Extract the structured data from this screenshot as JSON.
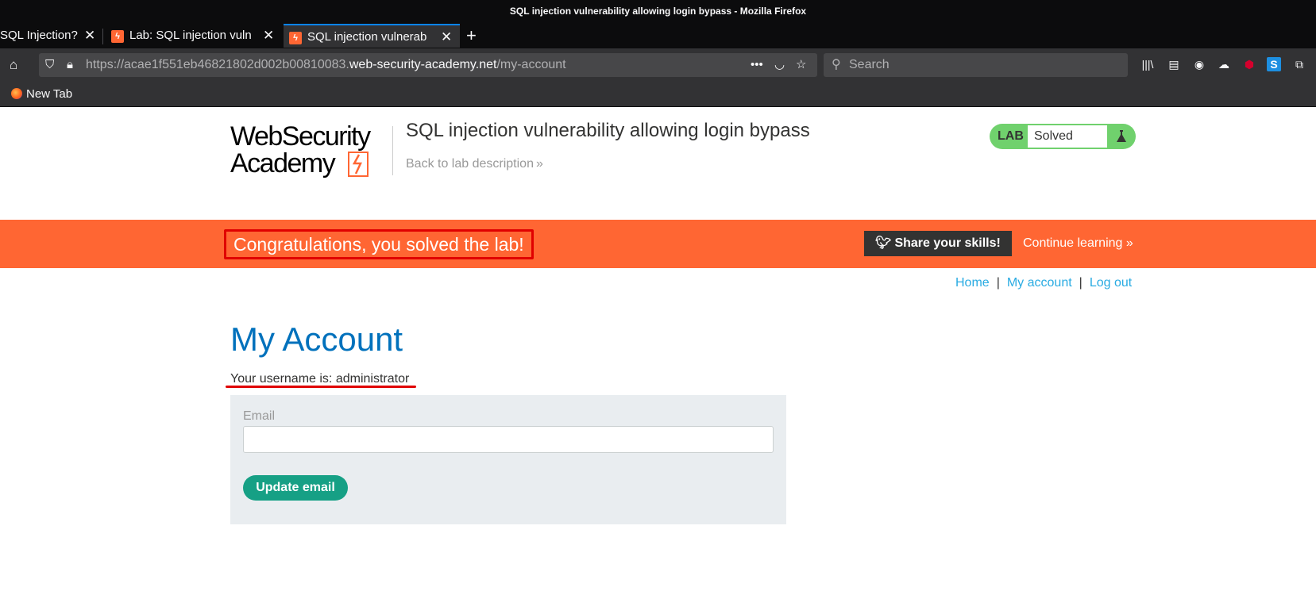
{
  "window": {
    "title": "SQL injection vulnerability allowing login bypass - Mozilla Firefox"
  },
  "tabs": [
    {
      "label": "SQL Injection?"
    },
    {
      "label": "Lab: SQL injection vuln"
    },
    {
      "label": "SQL injection vulnerab"
    }
  ],
  "address_bar": {
    "url_prefix": "https://acae1f551eb46821802d002b00810083.",
    "url_host": "web-security-academy.net",
    "url_path": "/my-account"
  },
  "search": {
    "placeholder": "Search"
  },
  "bookmarks": [
    {
      "label": "New Tab"
    }
  ],
  "header": {
    "logo_line1": "WebSecurity",
    "logo_line2": "Academy",
    "lab_title": "SQL injection vulnerability allowing login bypass",
    "back_link": "Back to lab description",
    "lab_tag": "LAB",
    "lab_status": "Solved"
  },
  "banner": {
    "message": "Congratulations, you solved the lab!",
    "share_label": "Share your skills!",
    "continue_label": "Continue learning"
  },
  "top_links": {
    "home": "Home",
    "my_account": "My account",
    "logout": "Log out",
    "separator": "|"
  },
  "main": {
    "heading": "My Account",
    "username_text": "Your username is: administrator",
    "email_label": "Email",
    "email_value": "",
    "update_button": "Update email"
  },
  "colors": {
    "accent_orange": "#ff6633",
    "link_blue": "#29abe2",
    "heading_blue": "#0071bc",
    "button_green": "#16a085",
    "status_green": "#70d16d",
    "highlight_red": "#e00000"
  }
}
